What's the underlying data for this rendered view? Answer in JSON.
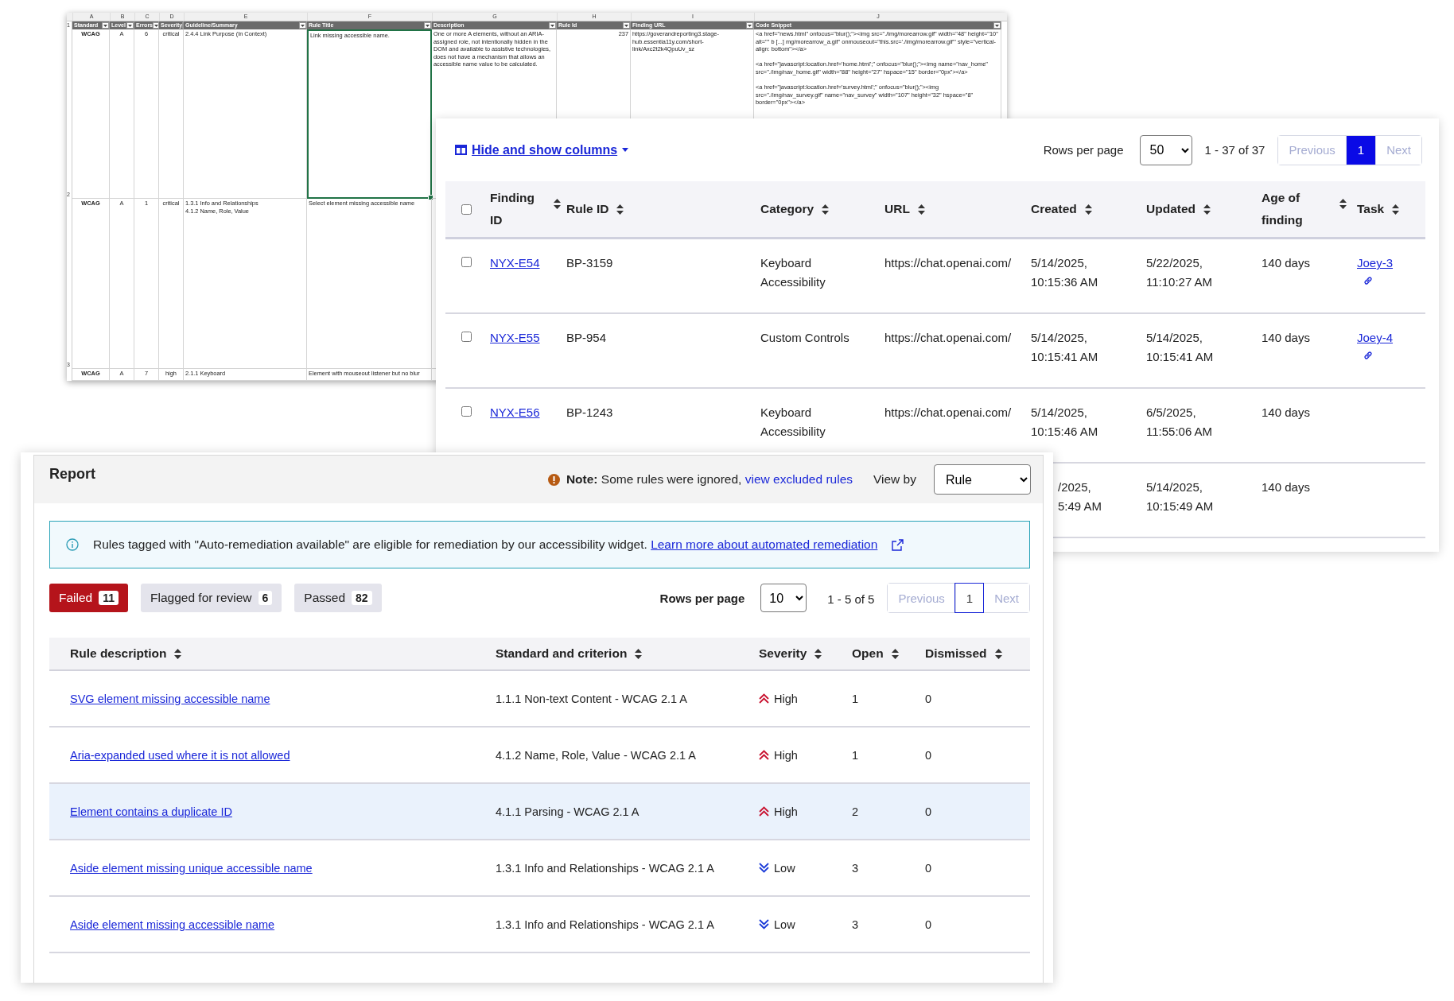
{
  "spreadsheet": {
    "column_letters": [
      "A",
      "B",
      "C",
      "D",
      "E",
      "F",
      "G",
      "H",
      "I",
      "J"
    ],
    "header_number": "1",
    "headers": [
      "Standard",
      "Level",
      "Errors",
      "Severity",
      "Guideline/Summary",
      "Rule Title",
      "Description",
      "Rule Id",
      "Finding URL",
      "Code Snippet"
    ],
    "rows": [
      {
        "number": "2",
        "cells": [
          {
            "text": "WCAG",
            "selected": false
          },
          {
            "text": "A",
            "selected": false
          },
          {
            "text": "6",
            "selected": false
          },
          {
            "text": "critical",
            "selected": false
          },
          {
            "text": "2.4.4 Link Purpose (In Context)",
            "selected": false
          },
          {
            "text": "Link missing accessible name.",
            "selected": true
          },
          {
            "text": "One or more A elements, without an ARIA-assigned role, not intentionally hidden in the DOM and available to assistive technologies, does not have a mechanism that allows an accessible name value to be calculated.",
            "selected": false
          },
          {
            "text": "237",
            "selected": false
          },
          {
            "text": "https://goverandreporting3.stage-hub.essentia11y.com/short-link/Axc2t2k4QpuUv_sz",
            "selected": false
          },
          {
            "text": "<a href=\"news.html\" onfocus=\"blur();\"><img src=\"./img/morearrow.gif\" width=\"48\" height=\"10\" alt=\"\" b [...] mg/morearrow_a.gif\" onmouseout=\"this.src='./img/morearrow.gif'\" style=\"vertical-align: bottom\"></a>\n\n<a href=\"javascript:location.href='home.html';\" onfocus=\"blur();\"><img name=\"nav_home\" src=\"./img/nav_home.gif\" width=\"88\" height=\"27\" hspace=\"15\" border=\"0px\"></a>\n\n<a href=\"javascript:location.href='survey.html';\" onfocus=\"blur();\"><img src=\"./img/nav_survey.gif\" name=\"nav_survey\" width=\"107\" height=\"32\" hspace=\"8\" border=\"0px\"></a>",
            "selected": false
          }
        ]
      },
      {
        "number": "3",
        "cells": [
          {
            "text": "WCAG",
            "selected": false
          },
          {
            "text": "A",
            "selected": false
          },
          {
            "text": "1",
            "selected": false
          },
          {
            "text": "critical",
            "selected": false
          },
          {
            "text": "1.3.1 Info and Relationships\n4.1.2 Name, Role, Value",
            "selected": false
          },
          {
            "text": "Select element missing accessible name",
            "selected": false
          }
        ]
      },
      {
        "cells": [
          {
            "text": "WCAG",
            "selected": false
          },
          {
            "text": "A",
            "selected": false
          },
          {
            "text": "7",
            "selected": false
          },
          {
            "text": "high",
            "selected": false
          },
          {
            "text": "2.1.1 Keyboard",
            "selected": false
          },
          {
            "text": "Element with mouseout listener but no blur",
            "selected": false
          }
        ]
      }
    ]
  },
  "findings": {
    "columns_menu": "Hide and show columns",
    "rows_per_page_label": "Rows per page",
    "rows_per_page": "50",
    "range": "1 - 37 of 37",
    "pager": [
      {
        "label": "Previous",
        "selected": false,
        "disabled": true
      },
      {
        "label": "1",
        "selected": true,
        "disabled": false
      },
      {
        "label": "Next",
        "selected": false,
        "disabled": true
      }
    ],
    "all_checked": false,
    "columns": [
      "Finding ID",
      "Rule ID",
      "Category",
      "URL",
      "Created",
      "Updated",
      "Age of finding",
      "Task"
    ],
    "rows": [
      {
        "checked": false,
        "finding_id": "NYX-E54",
        "rule_id": "BP-3159",
        "category": "Keyboard Accessibility",
        "url": "https://chat.openai.com/",
        "created": [
          "5/14/2025,",
          "10:15:36 AM"
        ],
        "updated": [
          "5/22/2025,",
          "11:10:27 AM"
        ],
        "age": "140 days",
        "task": "Joey-3"
      },
      {
        "checked": false,
        "finding_id": "NYX-E55",
        "rule_id": "BP-954",
        "category": "Custom Controls",
        "url": "https://chat.openai.com/",
        "created": [
          "5/14/2025,",
          "10:15:41 AM"
        ],
        "updated": [
          "5/14/2025,",
          "10:15:41 AM"
        ],
        "age": "140 days",
        "task": "Joey-4"
      },
      {
        "checked": false,
        "finding_id": "NYX-E56",
        "rule_id": "BP-1243",
        "category": "Keyboard Accessibility",
        "url": "https://chat.openai.com/",
        "created": [
          "5/14/2025,",
          "10:15:46 AM"
        ],
        "updated": [
          "6/5/2025,",
          "11:55:06 AM"
        ],
        "age": "140 days"
      },
      {
        "created": [
          "/2025,",
          "5:49 AM"
        ],
        "updated": [
          "5/14/2025,",
          "10:15:49 AM"
        ],
        "age": "140 days"
      }
    ]
  },
  "report": {
    "title": "Report",
    "note_label": "Note:",
    "note_text": "Some rules were ignored,",
    "note_link": "view excluded rules",
    "view_by_label": "View by",
    "view_by": "Rule",
    "info_text": "Rules tagged with \"Auto-remediation available\" are eligible for remediation by our accessibility widget.",
    "info_link": "Learn more about automated remediation",
    "tabs": [
      {
        "label": "Failed",
        "count": "11",
        "selected": true
      },
      {
        "label": "Flagged for review",
        "count": "6",
        "selected": false
      },
      {
        "label": "Passed",
        "count": "82",
        "selected": false
      }
    ],
    "rows_per_page_label": "Rows per page",
    "rows_per_page": "10",
    "range": "1 - 5 of 5",
    "pager": [
      {
        "label": "Previous",
        "selected": false,
        "disabled": true
      },
      {
        "label": "1",
        "selected": true,
        "disabled": false
      },
      {
        "label": "Next",
        "selected": false,
        "disabled": true
      }
    ],
    "columns": [
      "Rule description",
      "Standard and criterion",
      "Severity",
      "Open",
      "Dismissed"
    ],
    "rows": [
      {
        "rule": "SVG element missing accessible name",
        "standard": "1.1.1 Non-text Content - WCAG 2.1 A",
        "severity": "High",
        "kind": "high",
        "open": "1",
        "dismissed": "0",
        "highlighted": false
      },
      {
        "rule": "Aria-expanded used where it is not allowed",
        "standard": "4.1.2 Name, Role, Value - WCAG 2.1 A",
        "severity": "High",
        "kind": "high",
        "open": "1",
        "dismissed": "0",
        "highlighted": false
      },
      {
        "rule": "Element contains a duplicate ID",
        "standard": "4.1.1 Parsing - WCAG 2.1 A",
        "severity": "High",
        "kind": "high",
        "open": "2",
        "dismissed": "0",
        "highlighted": true
      },
      {
        "rule": "Aside element missing unique accessible name",
        "standard": "1.3.1 Info and Relationships - WCAG 2.1 A",
        "severity": "Low",
        "kind": "low",
        "open": "3",
        "dismissed": "0",
        "highlighted": false
      },
      {
        "rule": "Aside element missing accessible name",
        "standard": "1.3.1 Info and Relationships - WCAG 2.1 A",
        "severity": "Low",
        "kind": "low",
        "open": "3",
        "dismissed": "0",
        "highlighted": false
      }
    ]
  }
}
